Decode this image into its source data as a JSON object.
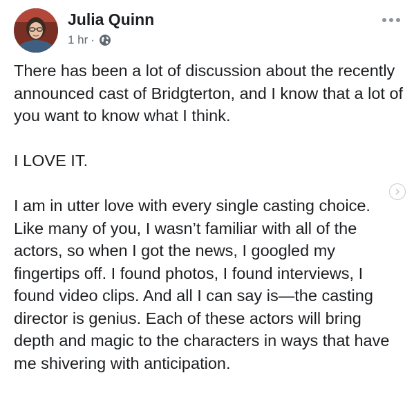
{
  "post": {
    "author": "Julia Quinn",
    "timestamp": "1 hr",
    "separator": "·",
    "privacy_icon": "globe-icon",
    "more_icon": "more-options-icon",
    "paragraphs": [
      "There has been a lot of discussion about the recently announced cast of Bridgterton, and I know that a lot of you want to know what I think.",
      "I LOVE IT.",
      "I am in utter love with every single casting choice. Like many of you, I wasn’t familiar with all of the actors, so when I got the news, I googled my fingertips off. I found photos, I found interviews, I found video clips. And all I can say is—the casting director is genius. Each of these actors will bring depth and magic to the characters in ways that have me shivering with anticipation."
    ]
  },
  "colors": {
    "text": "#1c1e21",
    "secondary_text": "#606770",
    "icon_gray": "#8d949e"
  },
  "nav": {
    "next_icon": "chevron-right-icon"
  }
}
